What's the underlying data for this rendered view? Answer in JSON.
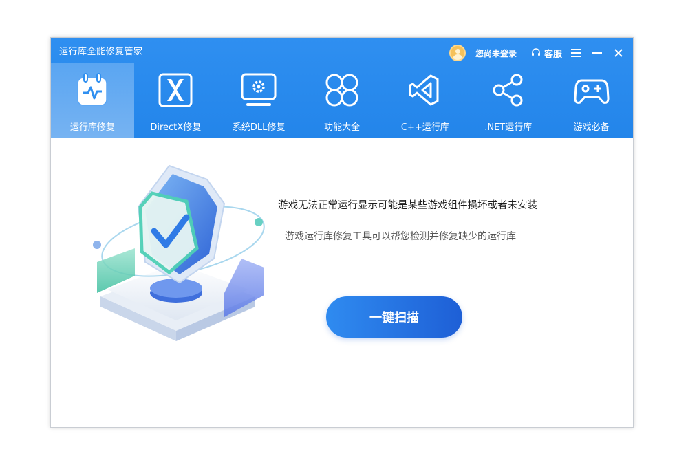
{
  "app": {
    "title": "运行库全能修复管家"
  },
  "topbar": {
    "login_text": "您尚未登录",
    "service_label": "客服"
  },
  "tabs": [
    {
      "label": "运行库修复",
      "icon": "calendar-pulse-icon",
      "active": true
    },
    {
      "label": "DirectX修复",
      "icon": "directx-x-icon",
      "active": false
    },
    {
      "label": "系统DLL修复",
      "icon": "monitor-gear-icon",
      "active": false
    },
    {
      "label": "功能大全",
      "icon": "clover-icon",
      "active": false
    },
    {
      "label": "C++运行库",
      "icon": "visual-studio-icon",
      "active": false
    },
    {
      "label": ".NET运行库",
      "icon": "share-icon",
      "active": false
    },
    {
      "label": "游戏必备",
      "icon": "gamepad-icon",
      "active": false
    }
  ],
  "main": {
    "headline": "游戏无法正常运行显示可能是某些游戏组件损坏或者未安装",
    "subline": "游戏运行库修复工具可以帮您检测并修复缺少的运行库",
    "scan_button": "一键扫描"
  },
  "colors": {
    "header": "#2385ea",
    "scan_button_start": "#2f8bf0",
    "scan_button_end": "#1e5fd6"
  }
}
